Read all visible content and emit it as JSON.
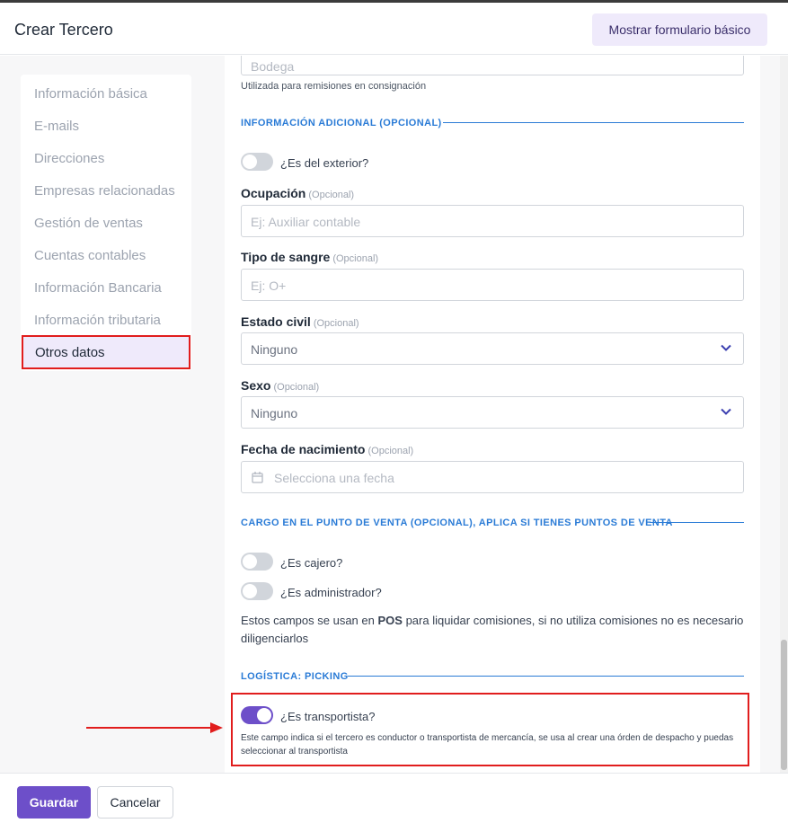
{
  "header": {
    "title": "Crear Tercero",
    "basic_form_button": "Mostrar formulario básico"
  },
  "sidebar": {
    "items": [
      {
        "label": "Información básica"
      },
      {
        "label": "E-mails"
      },
      {
        "label": "Direcciones"
      },
      {
        "label": "Empresas relacionadas"
      },
      {
        "label": "Gestión de ventas"
      },
      {
        "label": "Cuentas contables"
      },
      {
        "label": "Información Bancaria"
      },
      {
        "label": "Información tributaria"
      },
      {
        "label": "Otros datos"
      }
    ]
  },
  "form": {
    "bodega": {
      "placeholder": "Bodega",
      "help": "Utilizada para remisiones en consignación"
    },
    "section_additional": "INFORMACIÓN ADICIONAL (OPCIONAL)",
    "exterior_toggle": {
      "label": "¿Es del exterior?",
      "on": false
    },
    "ocupacion": {
      "label": "Ocupación",
      "optional": "(Opcional)",
      "placeholder": "Ej: Auxiliar contable"
    },
    "tipo_sangre": {
      "label": "Tipo de sangre",
      "optional": "(Opcional)",
      "placeholder": "Ej: O+"
    },
    "estado_civil": {
      "label": "Estado civil",
      "optional": "(Opcional)",
      "value": "Ninguno"
    },
    "sexo": {
      "label": "Sexo",
      "optional": "(Opcional)",
      "value": "Ninguno"
    },
    "fecha_nacimiento": {
      "label": "Fecha de nacimiento",
      "optional": "(Opcional)",
      "placeholder": "Selecciona una fecha"
    },
    "section_pos": "CARGO EN EL PUNTO DE VENTA (OPCIONAL), APLICA SI TIENES PUNTOS DE VENTA",
    "cajero_toggle": {
      "label": "¿Es cajero?",
      "on": false
    },
    "admin_toggle": {
      "label": "¿Es administrador?",
      "on": false
    },
    "pos_note_before": "Estos campos se usan en ",
    "pos_note_bold": "POS",
    "pos_note_after": " para liquidar comisiones, si no utiliza comisiones no es necesario diligenciarlos",
    "section_logistics": "LOGÍSTICA: PICKING",
    "transportista_toggle": {
      "label": "¿Es transportista?",
      "on": true
    },
    "transportista_help": "Este campo indica si el tercero es conductor o transportista de mercancía, se usa al crear una órden de despacho y puedas seleccionar al transportista"
  },
  "footer": {
    "save": "Guardar",
    "cancel": "Cancelar"
  },
  "colors": {
    "accent": "#6d4fc9",
    "section_blue": "#2a7bd6",
    "highlight_red": "#e11d1d"
  }
}
